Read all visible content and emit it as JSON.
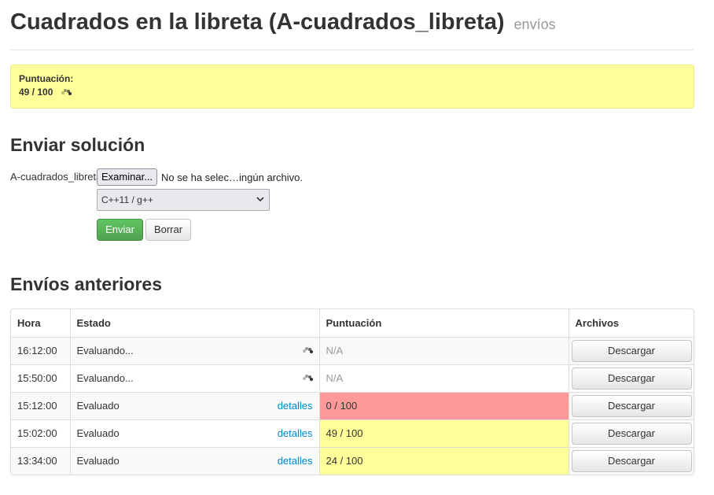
{
  "header": {
    "title": "Cuadrados en la libreta (A-cuadrados_libreta)",
    "subtitle": "envíos"
  },
  "score_box": {
    "label": "Puntuación:",
    "value": "49 / 100"
  },
  "submit": {
    "heading": "Enviar solución",
    "file_label": "A-cuadrados_libreta",
    "file_button": "Examinar...",
    "file_status": "No se ha selec…ingún archivo.",
    "language": "C++11 / g++",
    "send_label": "Enviar",
    "clear_label": "Borrar"
  },
  "previous": {
    "heading": "Envíos anteriores",
    "columns": [
      "Hora",
      "Estado",
      "Puntuación",
      "Archivos"
    ],
    "rows": [
      {
        "time": "16:12:00",
        "status": "Evaluando...",
        "details": "",
        "score": "N/A",
        "download": "Descargar"
      },
      {
        "time": "15:50:00",
        "status": "Evaluando...",
        "details": "",
        "score": "N/A",
        "download": "Descargar"
      },
      {
        "time": "15:12:00",
        "status": "Evaluado",
        "details": "detalles",
        "score": "0 / 100",
        "download": "Descargar"
      },
      {
        "time": "15:02:00",
        "status": "Evaluado",
        "details": "detalles",
        "score": "49 / 100",
        "download": "Descargar"
      },
      {
        "time": "13:34:00",
        "status": "Evaluado",
        "details": "detalles",
        "score": "24 / 100",
        "download": "Descargar"
      }
    ]
  },
  "colors": {
    "score_yellow": "#ffff99",
    "score_red": "#ff9999",
    "success_green": "#51a351",
    "link_blue": "#0088cc"
  },
  "icons": {
    "loading": "loading-spinner-icon",
    "select_arrow": "chevron-down-icon"
  }
}
